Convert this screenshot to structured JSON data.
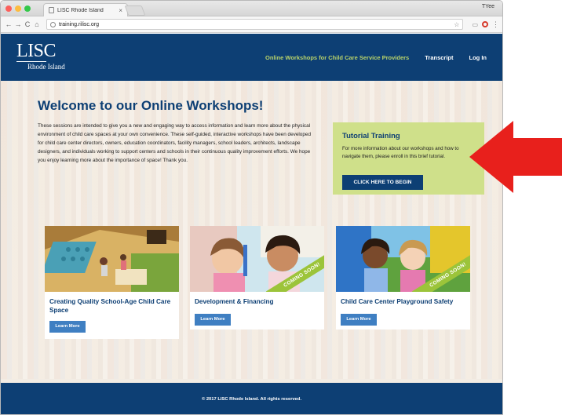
{
  "browser": {
    "tab_title": "LISC Rhode Island",
    "tab_close": "×",
    "profile": "TYee",
    "url": "training.rilisc.org",
    "nav_back": "←",
    "nav_forward": "→",
    "nav_reload": "C",
    "nav_home": "⌂",
    "star": "☆",
    "menu": "⋮",
    "lights": [
      "#fc605c",
      "#fdbc40",
      "#34c84a"
    ]
  },
  "site": {
    "logo_big": "LISC",
    "logo_small": "Rhode Island",
    "nav": {
      "workshops": "Online Workshops for Child Care Service Providers",
      "transcript": "Transcript",
      "login": "Log In"
    },
    "welcome_title": "Welcome to our Online Workshops!",
    "intro_text": "These sessions are intended to give you a new and engaging way to access information and learn more about the physical environment of child care spaces at your own convenience. These self-guided, interactive workshops have been developed for child care center directors, owners, education coordinators, facility managers, school leaders, architects, landscape designers, and individuals working to support centers and schools in their continuous quality improvement efforts. We hope you enjoy learning more about the importance of space! Thank you.",
    "tutorial": {
      "title": "Tutorial Training",
      "text": "For more information about our workshops and how to navigate them, please enroll in this brief tutorial.",
      "button": "CLICK HERE TO BEGIN"
    },
    "cards": [
      {
        "title": "Creating Quality School-Age Child Care Space",
        "button": "Learn More",
        "ribbon": ""
      },
      {
        "title": "Development & Financing",
        "button": "Learn More",
        "ribbon": "COMING SOON!"
      },
      {
        "title": "Child Care Center Playground Safety",
        "button": "Learn More",
        "ribbon": "COMING SOON!"
      }
    ],
    "footer": "© 2017 LISC Rhode Island. All rights reserved."
  },
  "colors": {
    "brand_blue": "#0d3f74",
    "accent_green": "#cfe08a",
    "nav_green": "#b9d36a",
    "arrow_red": "#e8201c",
    "button_blue": "#3f7fc2"
  }
}
